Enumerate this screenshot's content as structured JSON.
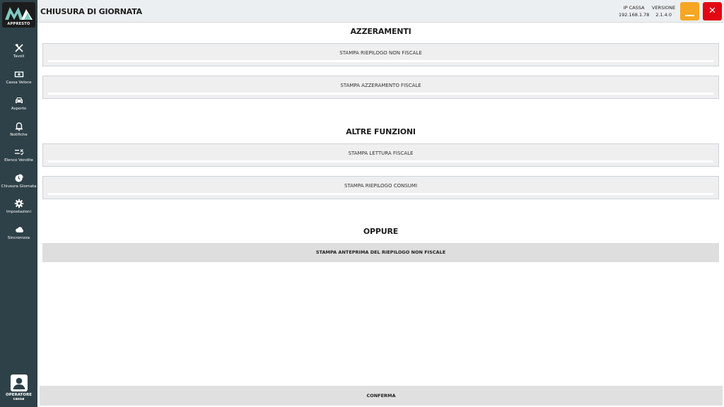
{
  "brand": {
    "logo_text": "APPRESTO"
  },
  "sidebar": {
    "items": [
      {
        "label": "Tavoli",
        "icon": "fork-knife-icon"
      },
      {
        "label": "Cassa Veloce",
        "icon": "cash-icon"
      },
      {
        "label": "Asporto",
        "icon": "car-icon"
      },
      {
        "label": "Notifiche",
        "icon": "bell-icon"
      },
      {
        "label": "Elenco Vendite",
        "icon": "list-check-icon"
      },
      {
        "label": "Chiusura Giornata",
        "icon": "clock-pie-icon"
      },
      {
        "label": "Impostazioni",
        "icon": "gear-icon"
      },
      {
        "label": "Sincronizza",
        "icon": "cloud-icon"
      }
    ],
    "operator": {
      "title": "OPERATORE",
      "name": "cassa"
    }
  },
  "header": {
    "title": "CHIUSURA DI GIORNATA",
    "ip_label": "IP CASSA",
    "ip_value": "192.168.1.78",
    "version_label": "VERSIONE",
    "version_value": "2.1.4.0",
    "minimize_icon": "minimize-icon",
    "close_icon": "close-icon",
    "close_glyph": "✕",
    "colors": {
      "minimize": "#f5a623",
      "close": "#e30613"
    }
  },
  "main": {
    "sections": [
      {
        "title": "AZZERAMENTI",
        "buttons": [
          "STAMPA RIEPILOGO NON FISCALE",
          "STAMPA AZZERAMENTO FISCALE"
        ]
      },
      {
        "title": "ALTRE FUNZIONI",
        "buttons": [
          "STAMPA LETTURA FISCALE",
          "STAMPA RIEPILOGO CONSUMI"
        ]
      },
      {
        "title": "OPPURE",
        "buttons": [
          "STAMPA ANTEPRIMA DEL RIEPILOGO NON FISCALE"
        ]
      }
    ],
    "confirm_label": "CONFERMA"
  },
  "colors": {
    "sidebar": "#2e4148",
    "accent_logo": "#7ecbc0"
  }
}
